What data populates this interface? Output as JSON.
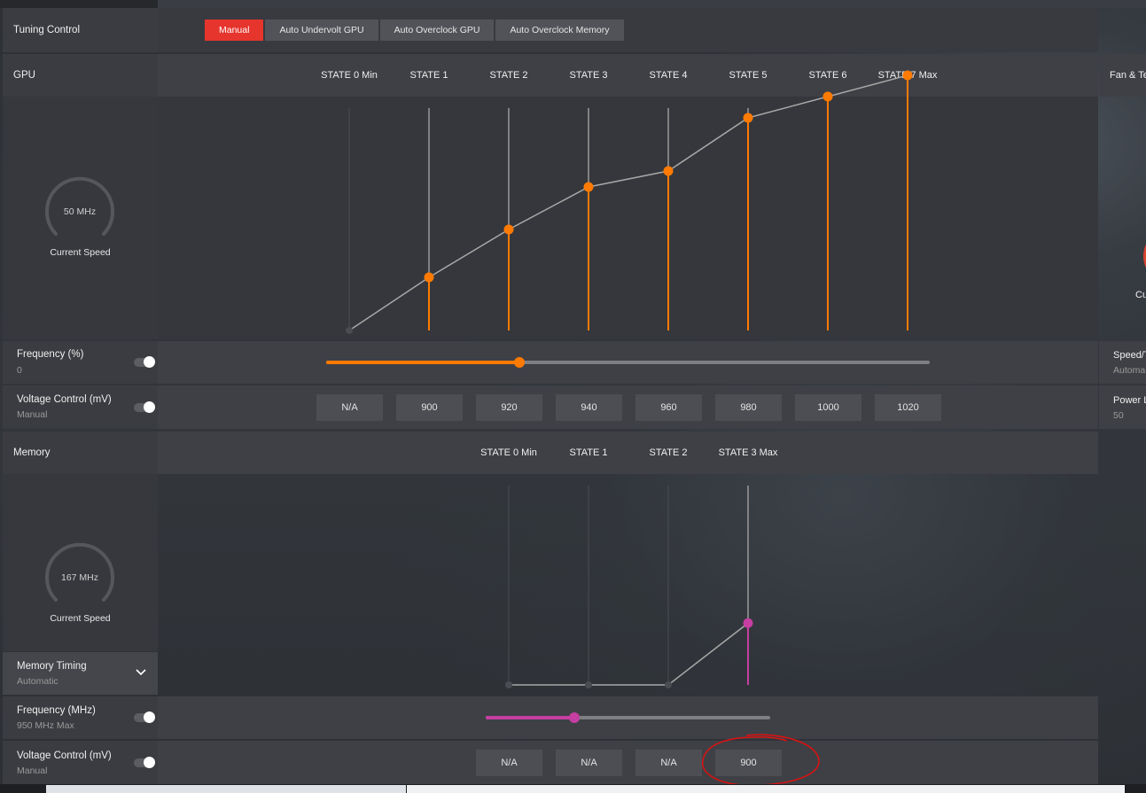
{
  "tuning": {
    "label": "Tuning Control",
    "tabs": [
      "Manual",
      "Auto Undervolt GPU",
      "Auto Overclock GPU",
      "Auto Overclock Memory"
    ],
    "active_tab": "Manual"
  },
  "gpu": {
    "title": "GPU",
    "gauge_value": "50 MHz",
    "gauge_caption": "Current Speed",
    "states": [
      "STATE 0 Min",
      "STATE 1",
      "STATE 2",
      "STATE 3",
      "STATE 4",
      "STATE 5",
      "STATE 6",
      "STATE 7 Max"
    ],
    "curve_levels": [
      0,
      0.1,
      0.19,
      0.27,
      0.3,
      0.4,
      0.44,
      0.48
    ],
    "frequency": {
      "label": "Frequency (%)",
      "value": "0",
      "slider_fraction": 0.32
    },
    "voltage": {
      "label": "Voltage Control (mV)",
      "mode": "Manual",
      "values": [
        "N/A",
        "900",
        "920",
        "940",
        "960",
        "980",
        "1000",
        "1020"
      ]
    }
  },
  "memory": {
    "title": "Memory",
    "gauge_value": "167 MHz",
    "gauge_caption": "Current Speed",
    "states": [
      "STATE 0 Min",
      "STATE 1",
      "STATE 2",
      "STATE 3 Max"
    ],
    "curve_levels": [
      0,
      0,
      0,
      0.31
    ],
    "timing": {
      "label": "Memory Timing",
      "value": "Automatic"
    },
    "frequency": {
      "label": "Frequency (MHz)",
      "value": "950 MHz Max",
      "slider_fraction": 0.31
    },
    "voltage": {
      "label": "Voltage Control (mV)",
      "mode": "Manual",
      "values": [
        "N/A",
        "N/A",
        "N/A",
        "900"
      ]
    }
  },
  "right_panel": {
    "title": "Fan & Te",
    "gauge_caption": "Cu",
    "speed_label": "Speed/T",
    "speed_value": "Automa",
    "power_label": "Power L",
    "power_value": "50"
  },
  "colors": {
    "accent_red": "#e5352d",
    "gpu_orange": "#ff7a00",
    "memory_magenta": "#c53ea2",
    "annotation_red": "#e01010"
  }
}
